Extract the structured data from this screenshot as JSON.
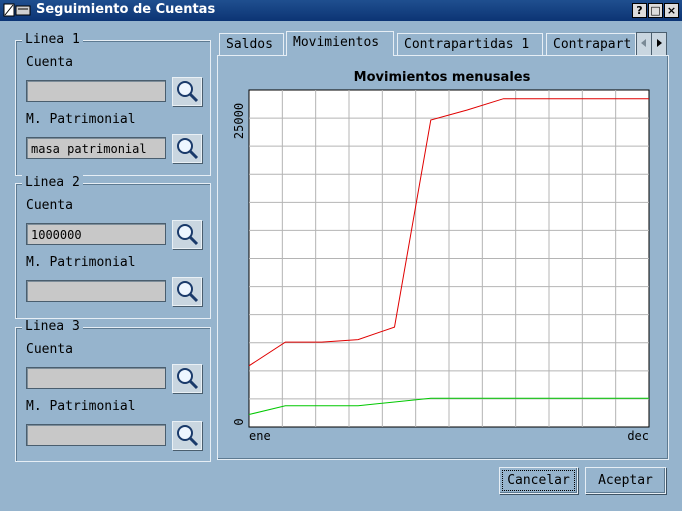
{
  "window": {
    "title": "Seguimiento de Cuentas",
    "buttons": {
      "help": "?",
      "maximize": "□",
      "close": "×"
    }
  },
  "groups": [
    {
      "legend": "Linea 1",
      "cuenta_label": "Cuenta",
      "cuenta_value": "",
      "masa_label": "M. Patrimonial",
      "masa_value": "masa patrimonial"
    },
    {
      "legend": "Linea 2",
      "cuenta_label": "Cuenta",
      "cuenta_value": "1000000",
      "masa_label": "M. Patrimonial",
      "masa_value": ""
    },
    {
      "legend": "Linea 3",
      "cuenta_label": "Cuenta",
      "cuenta_value": "",
      "masa_label": "M. Patrimonial",
      "masa_value": ""
    }
  ],
  "tabs": [
    "Saldos",
    "Movimientos",
    "Contrapartidas 1",
    "Contrapart"
  ],
  "active_tab": "Movimientos",
  "footer": {
    "cancel": "Cancelar",
    "accept": "Aceptar"
  },
  "colors": {
    "series_red": "#e00000",
    "series_green": "#00c800",
    "window_bg": "#96b4cd"
  },
  "chart_data": {
    "type": "line",
    "title": "Movimientos menusales",
    "x_tick_labels": [
      "ene",
      "dec"
    ],
    "y_tick_labels": [
      "0",
      "25000"
    ],
    "ylim": [
      0,
      27000
    ],
    "grid": true,
    "x": [
      1,
      2,
      3,
      4,
      5,
      6,
      7,
      8,
      9,
      10,
      11,
      12
    ],
    "series": [
      {
        "color": "#e00000",
        "values": [
          4900,
          6800,
          6800,
          7000,
          8000,
          24600,
          25400,
          26300,
          26300,
          26300,
          26300,
          26300
        ]
      },
      {
        "color": "#00c800",
        "values": [
          1000,
          1700,
          1700,
          1700,
          2000,
          2300,
          2300,
          2300,
          2300,
          2300,
          2300,
          2300
        ]
      }
    ]
  }
}
